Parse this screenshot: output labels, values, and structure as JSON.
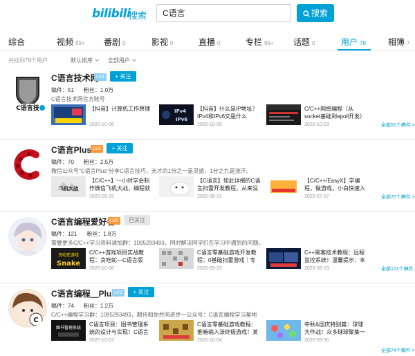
{
  "header": {
    "logo": "bilibili",
    "logo_sub": "搜索",
    "search_value": "C语言",
    "search_button": "搜索",
    "colors": {
      "accent": "#00a1d6",
      "lv_orange": "#ff9a3c",
      "lv_blue": "#8ed0f1"
    }
  },
  "tabs": [
    {
      "label": "综合",
      "count": ""
    },
    {
      "label": "视频",
      "count": "99+"
    },
    {
      "label": "番剧",
      "count": "0"
    },
    {
      "label": "影视",
      "count": "0"
    },
    {
      "label": "直播",
      "count": "0"
    },
    {
      "label": "专栏",
      "count": "99+"
    },
    {
      "label": "话题",
      "count": "0"
    },
    {
      "label": "用户",
      "count": "79"
    },
    {
      "label": "相簿",
      "count": "7"
    }
  ],
  "filter": {
    "result_text": "共找到79个用户",
    "sort": "默认排序",
    "type": "全部用户"
  },
  "users": [
    {
      "name": "C语言技术网",
      "level": "LV3",
      "follow": "+ 关注",
      "works": "稿件：51",
      "fans": "粉丝：1.0万",
      "desc": "C语言技术网官方账号",
      "more": "全部51个稿件 >",
      "videos": [
        {
          "title": "【抖音】计算机工作原理",
          "date": "2020-10-06"
        },
        {
          "title": "【抖音】什么是IP地址？IPv4和IPv6又是什么",
          "date": "2020-10-05"
        },
        {
          "title": "C/C++网络编程（从socket基础到epoll开发）",
          "date": "2020-10-03"
        }
      ]
    },
    {
      "name": "C语言Plus",
      "level": "LV5",
      "follow": "+ 关注",
      "works": "稿件：70",
      "fans": "粉丝：2.5万",
      "desc": "微信公众号\"C语言Plus\"分享C语言技巧，天才的1分之一是灵感，1分之九是流汗。",
      "more": "全部70个稿件 >",
      "videos": [
        {
          "title": "【C/C++】一小时学会制作微信飞机大战，编程就",
          "date": "2020-09-15"
        },
        {
          "title": "【C语言】如此详细的C语言扫雷开发教程，从来没",
          "date": "2020-08-11"
        },
        {
          "title": "【C/C++/EasyX】学编程，做游戏，小白快速入",
          "date": "2020-07-17"
        }
      ]
    },
    {
      "name": "C语言编程爱好者",
      "level": "LV5",
      "follow": "已关注",
      "works": "稿件：121",
      "fans": "粉丝：1.8万",
      "desc": "需要更多C/C++学习资料请加群：1095293493，同时解决同学们在学习中遇到的问题。",
      "more": "全部121个稿件 >",
      "videos": [
        {
          "title": "C/C++游戏项目实战教程：贪吃蛇—C语言版",
          "date": "2020-10-06"
        },
        {
          "title": "C语言零基础游戏开发教程：0基础扫雷游戏｜专",
          "date": "2020-09-23"
        },
        {
          "title": "C++黑客技术教程：远程监控系统！温馨提示：本",
          "date": "2020-09-19"
        }
      ]
    },
    {
      "name": "C语言编程＿Plus",
      "level": "LV3",
      "follow": "+ 关注",
      "works": "稿件：74",
      "fans": "粉丝：1.2万",
      "desc": "C/C++编程学习群：1095293493，期待和你共同进步～公众号：C语言编程学习基地",
      "more": "全部74个稿件 >",
      "videos": [
        {
          "title": "C语言项目：图书管理系统的设计与实现！C语言",
          "date": "2020-10-07"
        },
        {
          "title": "C语言零基础游戏教程：推箱输入法终极游戏！某",
          "date": "2020-10-04"
        },
        {
          "title": "中秋&国庆特别篇：球球大作战！众多球球聚集一",
          "date": "2020-09-30"
        }
      ]
    }
  ]
}
